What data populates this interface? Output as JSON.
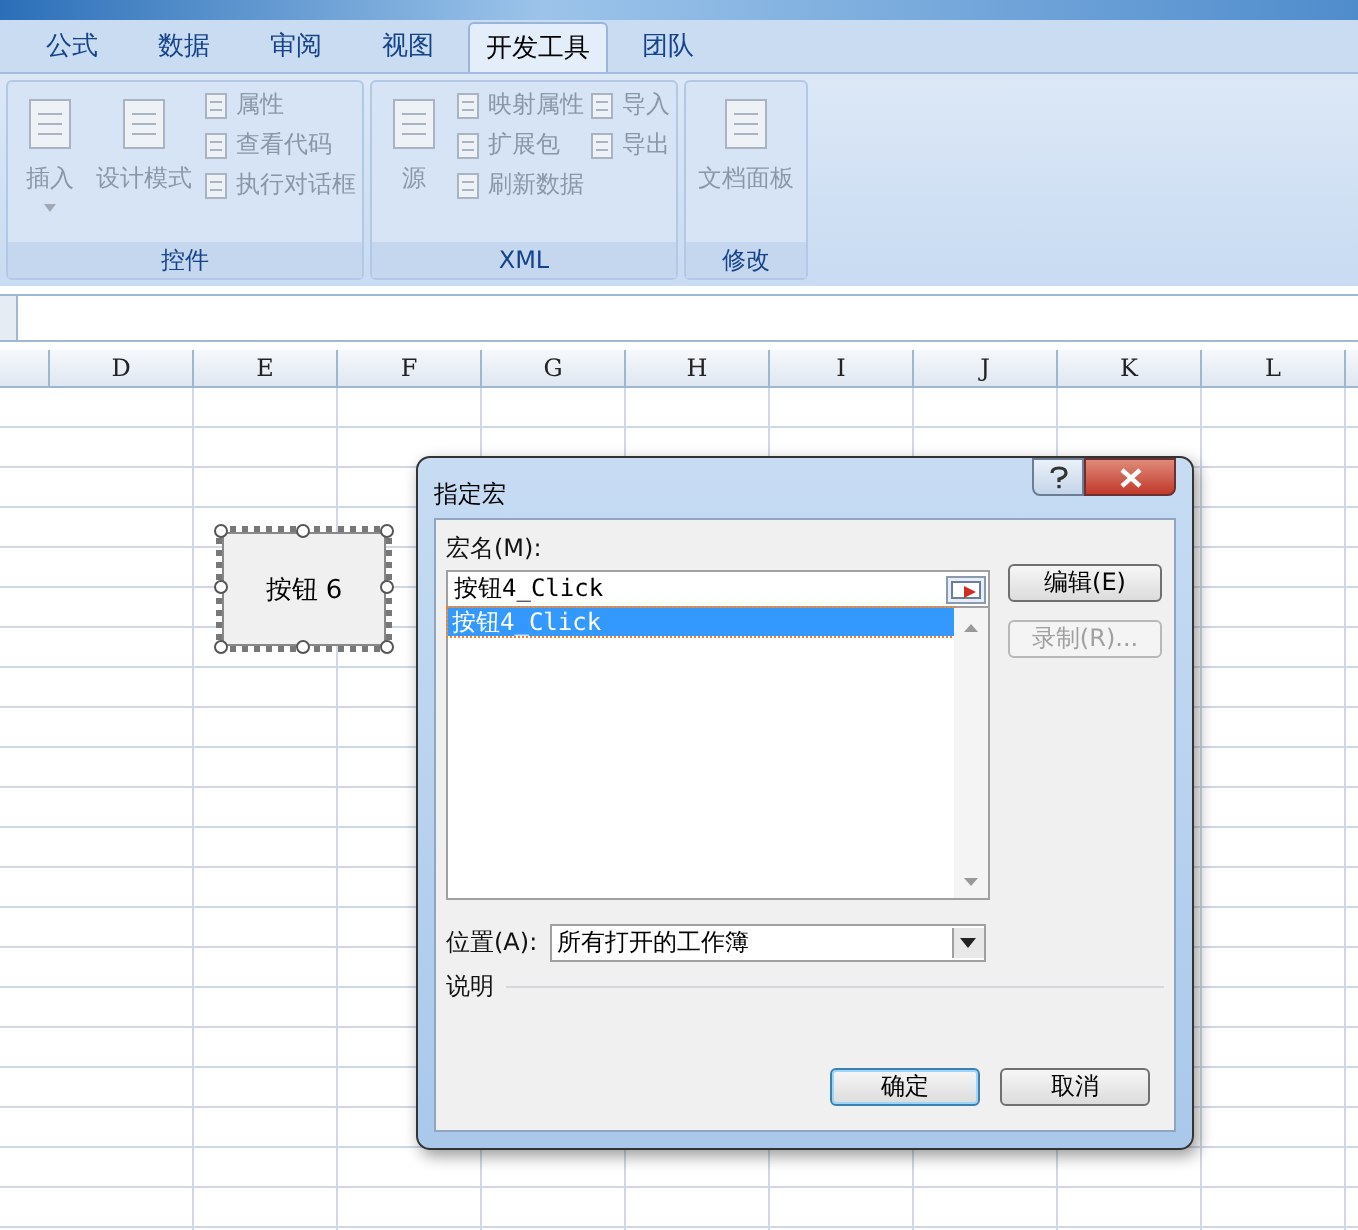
{
  "tabs": [
    {
      "label": "公式",
      "selected": false
    },
    {
      "label": "数据",
      "selected": false
    },
    {
      "label": "审阅",
      "selected": false
    },
    {
      "label": "视图",
      "selected": false
    },
    {
      "label": "开发工具",
      "selected": true
    },
    {
      "label": "团队",
      "selected": false
    }
  ],
  "ribbon_groups": [
    {
      "label": "控件",
      "large_items": [
        {
          "label": "插入",
          "dropdown": true
        },
        {
          "label": "设计模式",
          "dropdown": false
        }
      ],
      "small_columns": [
        [
          "属性",
          "查看代码",
          "执行对话框"
        ]
      ]
    },
    {
      "label": "XML",
      "large_items": [
        {
          "label": "源",
          "dropdown": false
        }
      ],
      "small_columns": [
        [
          "映射属性",
          "扩展包",
          "刷新数据"
        ],
        [
          "导入",
          "导出"
        ]
      ]
    },
    {
      "label": "修改",
      "large_items": [
        {
          "label": "文档面板",
          "dropdown": false
        }
      ]
    }
  ],
  "column_headers": [
    "D",
    "E",
    "F",
    "G",
    "H",
    "I",
    "J",
    "K",
    "L"
  ],
  "sheet_button": {
    "label": "按钮 6",
    "selected": true
  },
  "dialog": {
    "title": "指定宏",
    "macro_name_label": "宏名(M):",
    "macro_name_value": "按钮4_Click",
    "macro_list": [
      {
        "label": "按钮4_Click",
        "selected": true
      }
    ],
    "side_buttons": [
      {
        "label": "编辑(E)",
        "disabled": false
      },
      {
        "label": "录制(R)...",
        "disabled": true
      }
    ],
    "location_label": "位置(A):",
    "location_value": "所有打开的工作簿",
    "description_label": "说明",
    "footer_buttons": [
      {
        "label": "确定",
        "default": true
      },
      {
        "label": "取消",
        "default": false
      }
    ]
  }
}
